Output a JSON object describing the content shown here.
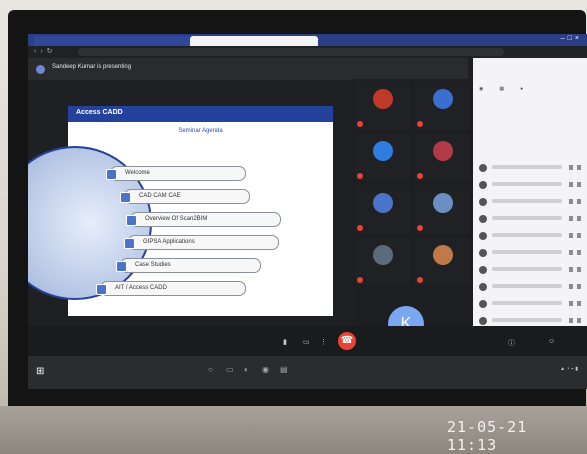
{
  "browser": {
    "tab1_label": "",
    "tab2_label": "",
    "url": ""
  },
  "meet": {
    "presenting_text": "Sandeep Kumar is presenting",
    "meeting_code": "",
    "end_call_icon": "phone-hangup"
  },
  "slide": {
    "title": "Access CADD",
    "logo": "",
    "subtitle": "Seminar Agenda",
    "center_label": "",
    "agenda": [
      "Welcome",
      "CAD CAM CAE",
      "Overview Of Scan2BIM",
      "GIPSA  Applications",
      "Case Studies",
      "AIT / Access CADD"
    ]
  },
  "participants": [
    {
      "name": "",
      "color": "#c0392b"
    },
    {
      "name": "",
      "color": "#3b6fcf"
    },
    {
      "name": "",
      "color": "#2f7de1"
    },
    {
      "name": "",
      "color": "#b03a48"
    },
    {
      "name": "",
      "color": "#4b73c9"
    },
    {
      "name": "",
      "color": "#6b8fc2"
    },
    {
      "name": "",
      "color": "#5c6b7a"
    },
    {
      "name": "",
      "color": "#c07a4a"
    }
  ],
  "featured_participant": {
    "initial": "K",
    "name": ""
  },
  "side_panel": {
    "title": ""
  },
  "photo_timestamp": "21-05-21 11:13"
}
